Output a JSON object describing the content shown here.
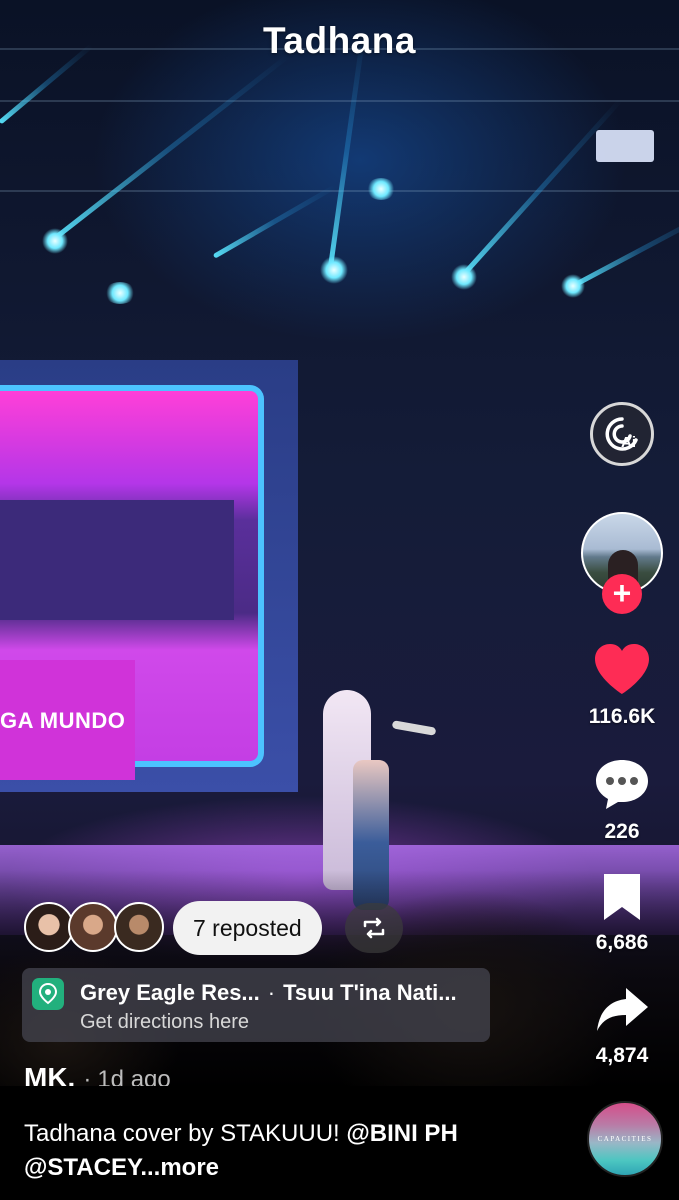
{
  "video": {
    "title": "Tadhana",
    "stage_screen_text": "GA MUNDO"
  },
  "rail": {
    "ai_label": "Ai",
    "likes": "116.6K",
    "comments": "226",
    "saves": "6,686",
    "shares": "4,874",
    "like_color": "#fe2c55",
    "follow_color": "#fe2c55"
  },
  "reposts": {
    "label": "7 reposted"
  },
  "location": {
    "name": "Grey Eagle Res...",
    "separator": "·",
    "secondary": "Tsuu T'ina Nati...",
    "subtitle": "Get directions here"
  },
  "author": {
    "name": "MK.",
    "dot": "·",
    "time": "1d ago"
  },
  "caption": {
    "text": "Tadhana cover by STAKUUU! ",
    "mention1": "@BINI PH",
    "mention2": "@STACEY",
    "more": "...more"
  },
  "sound": {
    "disc_label": "CAPACITIES"
  }
}
